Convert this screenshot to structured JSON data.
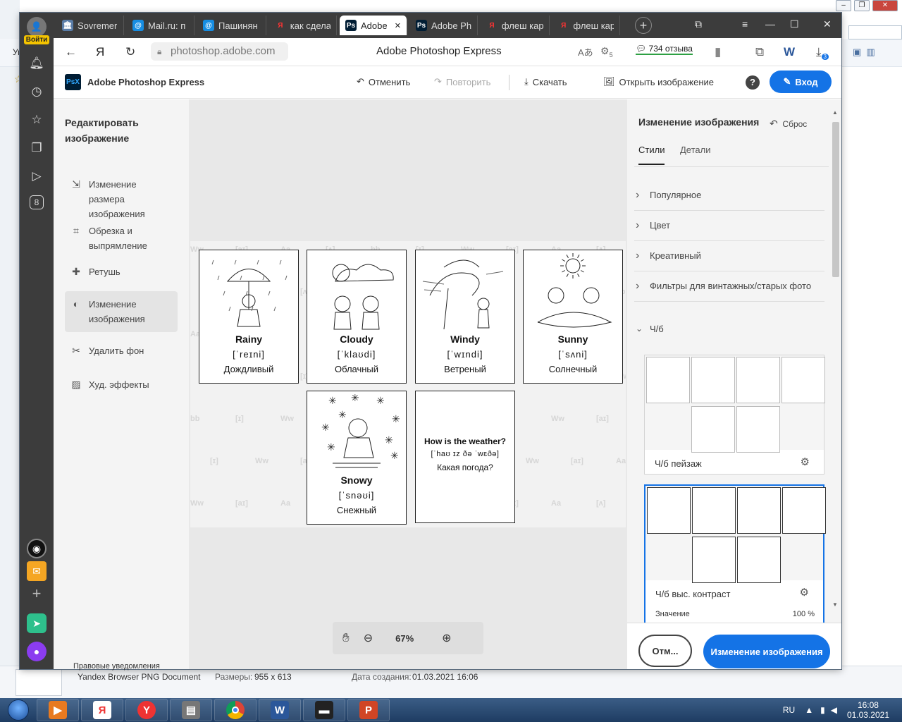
{
  "bg_window": {
    "statusbar": {
      "doc_type": "Yandex Browser PNG Document",
      "size_label": "Размеры:",
      "size_value": "955 x 613",
      "date_label": "Дата создания:",
      "date_value": "01.03.2021 16:06"
    },
    "side_text_1": "Ук",
    "side_text_2": "☆"
  },
  "browser": {
    "tabs": [
      {
        "label": "Sovremer",
        "icon": "bank-icon",
        "color": "#5a7da8"
      },
      {
        "label": "Mail.ru: п",
        "icon": "at-icon",
        "color": "#168de2"
      },
      {
        "label": "Пашинян",
        "icon": "at-icon",
        "color": "#168de2"
      },
      {
        "label": "как сдела",
        "icon": "yandex-icon",
        "color": "#f33"
      },
      {
        "label": "Adobe",
        "icon": "psx-icon",
        "color": "#001d34"
      },
      {
        "label": "Adobe Ph",
        "icon": "psx-icon",
        "color": "#001d34"
      },
      {
        "label": "флеш кар",
        "icon": "yandex-icon",
        "color": "#f33"
      },
      {
        "label": "флеш кар",
        "icon": "yandex-icon",
        "color": "#f33"
      }
    ],
    "login_badge": "Войти",
    "address": {
      "url": "photoshop.adobe.com",
      "page_title": "Adobe Photoshop Express",
      "reviews": "734 отзыва",
      "download_count": "3",
      "ext_badge": "5"
    },
    "rail_badge": "8"
  },
  "app": {
    "name": "Adobe Photoshop Express",
    "psx_logo": "PsX",
    "undo": "Отменить",
    "redo": "Повторить",
    "download": "Скачать",
    "open_image": "Открыть изображение",
    "login": "Вход",
    "left_panel": {
      "title": "Редактировать изображение",
      "items": [
        {
          "label": "Изменение размера изображения",
          "icon": "resize-icon"
        },
        {
          "label": "Обрезка и выпрямление",
          "icon": "crop-icon"
        },
        {
          "label": "Ретушь",
          "icon": "bandage-icon"
        },
        {
          "label": "Изменение изображения",
          "icon": "adjust-icon"
        },
        {
          "label": "Удалить фон",
          "icon": "remove-bg-icon"
        },
        {
          "label": "Худ. эффекты",
          "icon": "art-effects-icon"
        }
      ],
      "legal": "Правовые уведомления"
    },
    "cards": [
      {
        "en": "Rainy",
        "tr": "[ˈreɪni]",
        "ru": "Дождливый"
      },
      {
        "en": "Cloudy",
        "tr": "[ˈklaʊdi]",
        "ru": "Облачный"
      },
      {
        "en": "Windy",
        "tr": "[ˈwɪndi]",
        "ru": "Ветреный"
      },
      {
        "en": "Sunny",
        "tr": "[ˈsʌni]",
        "ru": "Солнечный"
      },
      {
        "en": "Snowy",
        "tr": "[ˈsnəʊi]",
        "ru": "Снежный"
      },
      {
        "en": "How is the weather?",
        "tr": "[ˈhaʊ ɪz ðə ˈwɛðə]",
        "ru": "Какая погода?"
      }
    ],
    "zoom": "67%",
    "right_panel": {
      "title": "Изменение изображения",
      "reset": "Сброс",
      "tabs": [
        "Стили",
        "Детали"
      ],
      "categories": [
        "Популярное",
        "Цвет",
        "Креативный",
        "Фильтры для винтажных/старых фото",
        "Ч/б"
      ],
      "presets": [
        {
          "name": "Ч/б пейзаж"
        },
        {
          "name": "Ч/б выс. контраст",
          "value_label": "Значение",
          "value": "100 %"
        }
      ],
      "cancel": "Отм...",
      "apply": "Изменение изображения"
    }
  },
  "taskbar": {
    "lang": "RU",
    "time": "16:08",
    "date": "01.03.2021"
  }
}
